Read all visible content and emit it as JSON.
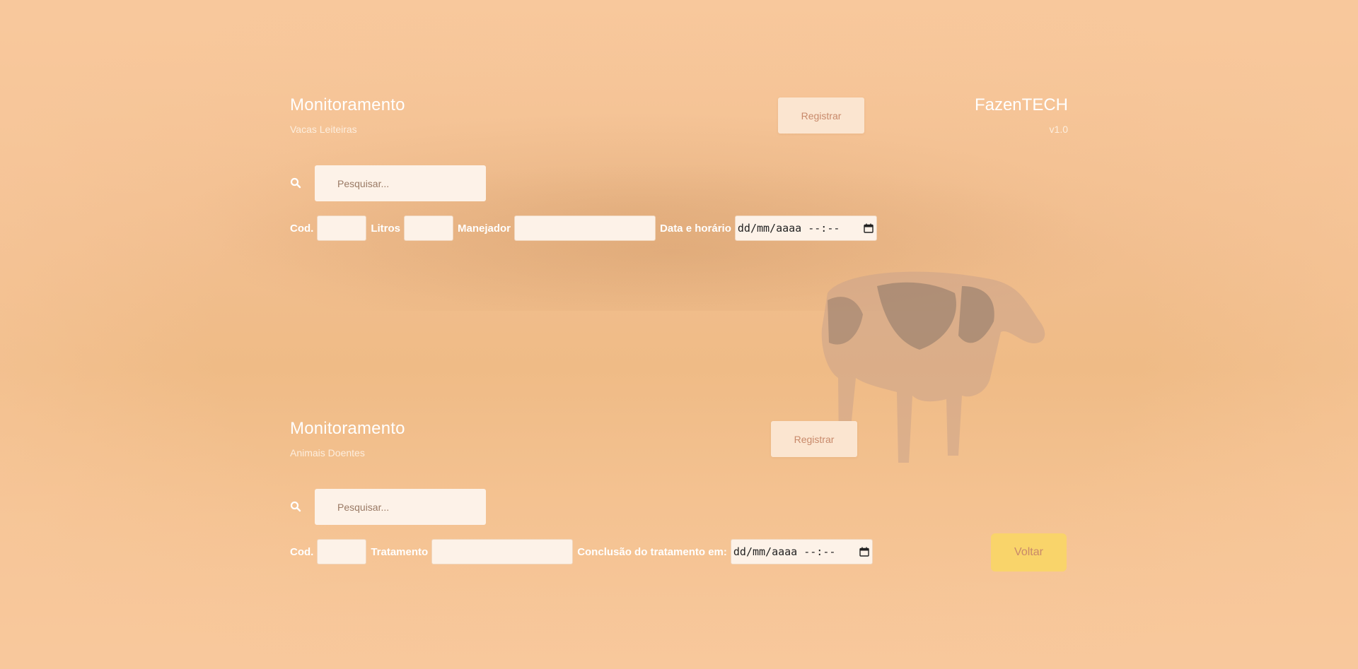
{
  "section1": {
    "title": "Monitoramento",
    "subtitle": "Vacas Leiteiras",
    "register_label": "Registrar",
    "search_placeholder": "Pesquisar...",
    "fields": {
      "cod_label": "Cod.",
      "litros_label": "Litros",
      "manejador_label": "Manejador",
      "datetime_label": "Data e horário",
      "datetime_value": "dd/mm/aaaa --:--"
    }
  },
  "brand": {
    "name": "FazenTECH",
    "version": "v1.0"
  },
  "section2": {
    "title": "Monitoramento",
    "subtitle": "Animais Doentes",
    "register_label": "Registrar",
    "search_placeholder": "Pesquisar...",
    "fields": {
      "cod_label": "Cod.",
      "tratamento_label": "Tratamento",
      "conclusao_label": "Conclusão do tratamento em:",
      "datetime_value": "dd/mm/aaaa --:--"
    }
  },
  "back_label": "Voltar",
  "icons": {
    "search": "search-icon",
    "calendar": "calendar-icon"
  },
  "colors": {
    "background": "#f8c89c",
    "input_bg": "#fdf2e8",
    "back_button": "#f9d46a",
    "button_text": "#c8896a"
  }
}
